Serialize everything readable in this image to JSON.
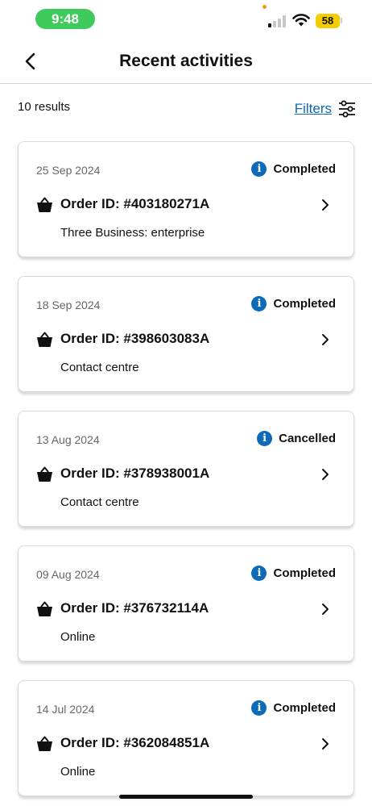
{
  "status_bar": {
    "time": "9:48",
    "battery": "58",
    "colors": {
      "time_pill": "#3ecb5c",
      "battery": "#f5cc00",
      "dot": "#f39a1f"
    },
    "icons": [
      "signal-icon",
      "wifi-icon",
      "battery-icon"
    ]
  },
  "header": {
    "title": "Recent activities",
    "back_icon": "chevron-left-icon"
  },
  "results": {
    "count_text": "10 results",
    "filters_label": "Filters",
    "filters_icon": "sliders-icon"
  },
  "colors": {
    "accent": "#0c6ab8",
    "card_border": "#d9d9d9",
    "text": "#111111",
    "muted": "#666666"
  },
  "activities": [
    {
      "date": "25 Sep 2024",
      "status": "Completed",
      "order_id": "Order ID: #403180271A",
      "channel": "Three Business: enterprise"
    },
    {
      "date": "18 Sep 2024",
      "status": "Completed",
      "order_id": "Order ID: #398603083A",
      "channel": "Contact centre"
    },
    {
      "date": "13 Aug 2024",
      "status": "Cancelled",
      "order_id": "Order ID: #378938001A",
      "channel": "Contact centre"
    },
    {
      "date": "09 Aug 2024",
      "status": "Completed",
      "order_id": "Order ID: #376732114A",
      "channel": "Online"
    },
    {
      "date": "14 Jul 2024",
      "status": "Completed",
      "order_id": "Order ID: #362084851A",
      "channel": "Online"
    }
  ],
  "info_glyph": "i"
}
